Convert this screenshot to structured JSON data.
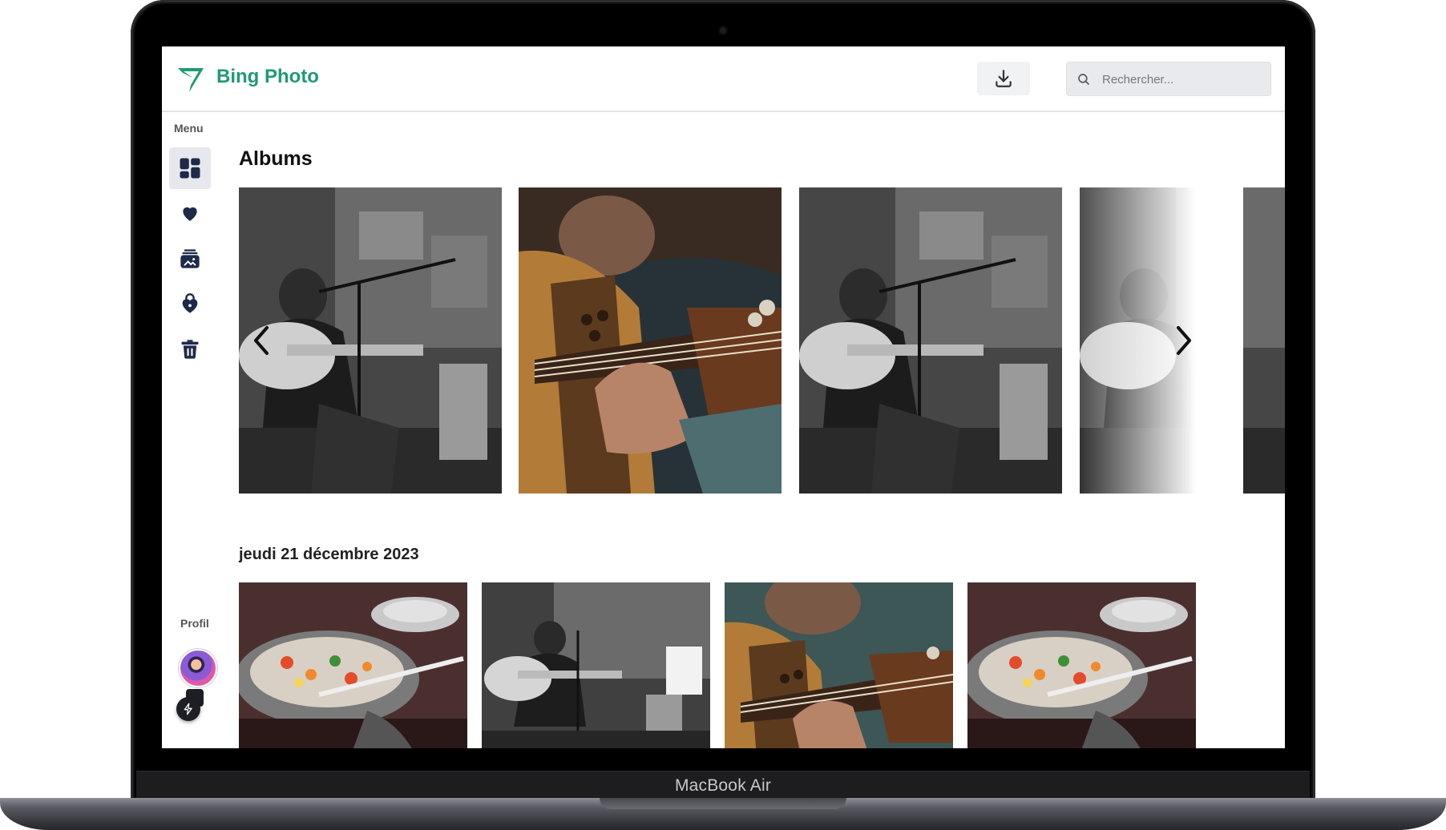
{
  "device": {
    "model_label": "MacBook Air"
  },
  "header": {
    "app_title": "Bing Photo",
    "brand_color": "#1f9a74",
    "download_icon": "download-icon",
    "search_placeholder": "Rechercher..."
  },
  "sidebar": {
    "menu_label": "Menu",
    "items": [
      {
        "icon": "dashboard-icon",
        "active": true
      },
      {
        "icon": "heart-icon",
        "active": false
      },
      {
        "icon": "album-icon",
        "active": false
      },
      {
        "icon": "lock-heart-icon",
        "active": false
      },
      {
        "icon": "trash-icon",
        "active": false
      }
    ],
    "profile_label": "Profil"
  },
  "main": {
    "albums_title": "Albums",
    "albums": [
      {
        "style": "black-and-white",
        "subject": "guitarist with microphone"
      },
      {
        "style": "color",
        "subject": "guitar close-up"
      },
      {
        "style": "black-and-white",
        "subject": "guitarist with microphone"
      },
      {
        "style": "black-and-white",
        "subject": "guitarist with microphone"
      }
    ],
    "date_group_title": "jeudi 21 décembre 2023",
    "photos": [
      {
        "style": "color",
        "subject": "wok with vegetables"
      },
      {
        "style": "black-and-white",
        "subject": "guitarist with microphone"
      },
      {
        "style": "color",
        "subject": "guitar close-up"
      },
      {
        "style": "color",
        "subject": "wok with vegetables"
      }
    ]
  }
}
